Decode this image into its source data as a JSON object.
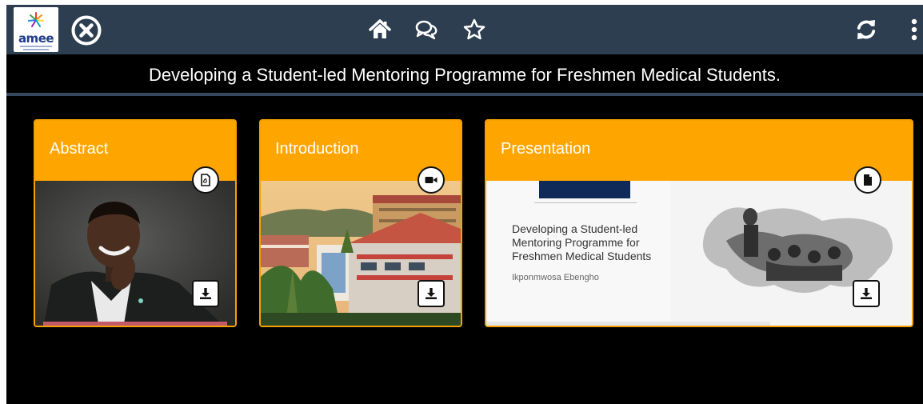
{
  "brand": {
    "logo_text": "amee"
  },
  "title": "Developing a Student-led Mentoring Programme for Freshmen Medical Students.",
  "cards": [
    {
      "label": "Abstract",
      "badge_icon": "pdf-icon"
    },
    {
      "label": "Introduction",
      "badge_icon": "video-camera-icon"
    },
    {
      "label": "Presentation",
      "badge_icon": "document-icon",
      "slide_title": "Developing a Student-led Mentoring Programme for Freshmen Medical Students",
      "slide_author": "Ikponmwosa Ebengho"
    }
  ],
  "colors": {
    "topbar": "#2c3e50",
    "accent": "#ffa500",
    "background": "#000000"
  }
}
